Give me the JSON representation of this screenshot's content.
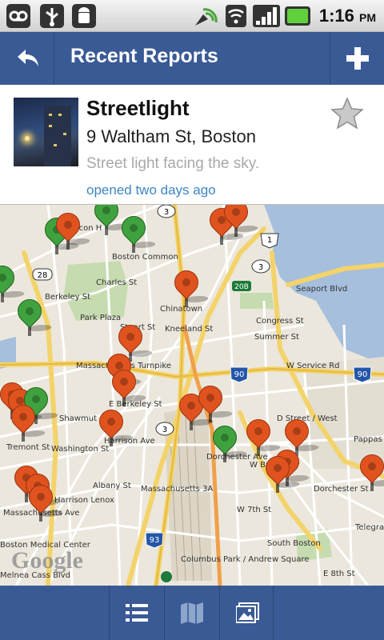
{
  "status_bar": {
    "time": "1:16",
    "ampm": "PM",
    "icons": [
      "voicemail-icon",
      "usb-icon",
      "android-debug-icon",
      "gps-icon",
      "wifi-icon",
      "signal-icon",
      "battery-icon"
    ]
  },
  "action_bar": {
    "title": "Recent Reports",
    "back_icon": "back-arrow-icon",
    "add_icon": "plus-icon"
  },
  "report": {
    "title": "Streetlight",
    "address": "9 Waltham St, Boston",
    "description": "Street light facing the sky.",
    "status": "opened two days ago",
    "favorite_icon": "star-icon"
  },
  "map": {
    "attribution": "Google",
    "labels": [
      "Boston Common",
      "Park Plaza",
      "Chinatown",
      "Stuart St",
      "Kneeland St",
      "Seaport Blvd",
      "Congress St",
      "Summer St",
      "Massachusetts Turnpike",
      "Shawmut",
      "Harrison Lenox",
      "Columbus Park / Andrew Square",
      "South Boston",
      "D Street / West",
      "Dorchester Ave",
      "W Broadway",
      "W 7th St",
      "E 8th St",
      "Tremont St",
      "Washington St",
      "Albany St",
      "Berkeley St",
      "Charles St",
      "Massachusetts Ave",
      "Boston Medical Center",
      "Telegraph",
      "Pappas Way",
      "E Berkeley St",
      "Harrison Ave",
      "Melnea Cass Blvd",
      "beacon H",
      "W Service Rd",
      "Dorchester St",
      "Massachusetts 3A"
    ],
    "route_shields": [
      "28",
      "1",
      "3",
      "20B",
      "90",
      "3",
      "93"
    ]
  },
  "toolbar": {
    "buttons": [
      {
        "name": "list-view-button",
        "icon": "list-icon"
      },
      {
        "name": "map-view-button",
        "icon": "map-icon"
      },
      {
        "name": "gallery-button",
        "icon": "photo-icon"
      }
    ]
  },
  "colors": {
    "action_bar": "#3a5a95",
    "link": "#3d86c4",
    "pin_open": "#e0531f",
    "pin_closed": "#3fa23f"
  }
}
